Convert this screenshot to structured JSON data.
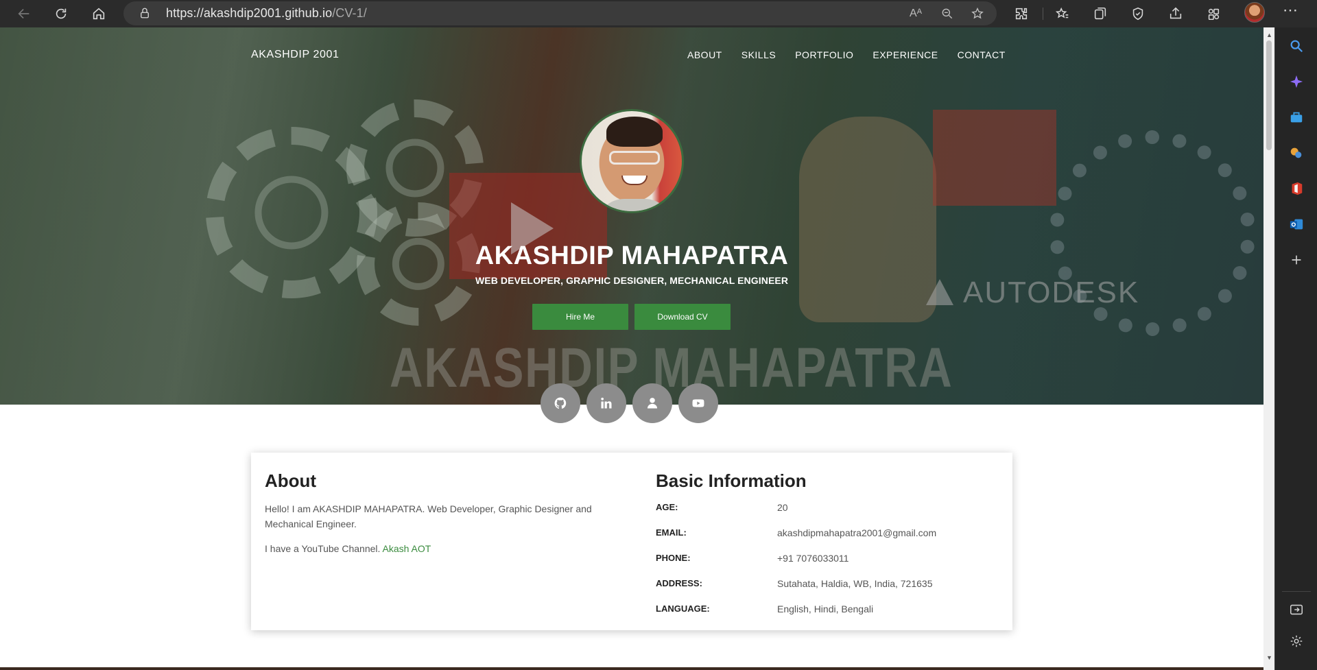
{
  "browser": {
    "url_host": "https://akashdip2001.github.io",
    "url_path": "/CV-1/",
    "read_aloud_label": "Aᴬ"
  },
  "nav": {
    "brand": "AKASHDIP 2001",
    "items": [
      {
        "label": "ABOUT"
      },
      {
        "label": "SKILLS"
      },
      {
        "label": "PORTFOLIO"
      },
      {
        "label": "EXPERIENCE"
      },
      {
        "label": "CONTACT"
      }
    ]
  },
  "hero": {
    "name": "AKASHDIP MAHAPATRA",
    "subtitle": "WEB DEVELOPER, GRAPHIC DESIGNER, MECHANICAL ENGINEER",
    "hire_label": "Hire Me",
    "cv_label": "Download CV",
    "background_text": "AKASHDIP MAHAPATRA",
    "background_brand": "AUTODESK",
    "accent_color": "#3a8b3e"
  },
  "socials": [
    {
      "icon": "github-icon"
    },
    {
      "icon": "linkedin-icon"
    },
    {
      "icon": "user-icon"
    },
    {
      "icon": "youtube-icon"
    }
  ],
  "about": {
    "title": "About",
    "p1": "Hello! I am AKASHDIP MAHAPATRA. Web Developer, Graphic Designer and Mechanical Engineer.",
    "p2_prefix": "I have a YouTube Channel. ",
    "p2_link": "Akash AOT"
  },
  "basic_info": {
    "title": "Basic Information",
    "rows": [
      {
        "label": "AGE:",
        "value": "20"
      },
      {
        "label": "EMAIL:",
        "value": "akashdipmahapatra2001@gmail.com"
      },
      {
        "label": "PHONE:",
        "value": "+91 7076033011"
      },
      {
        "label": "ADDRESS:",
        "value": "Sutahata, Haldia, WB, India, 721635"
      },
      {
        "label": "LANGUAGE:",
        "value": "English, Hindi, Bengali"
      }
    ]
  }
}
